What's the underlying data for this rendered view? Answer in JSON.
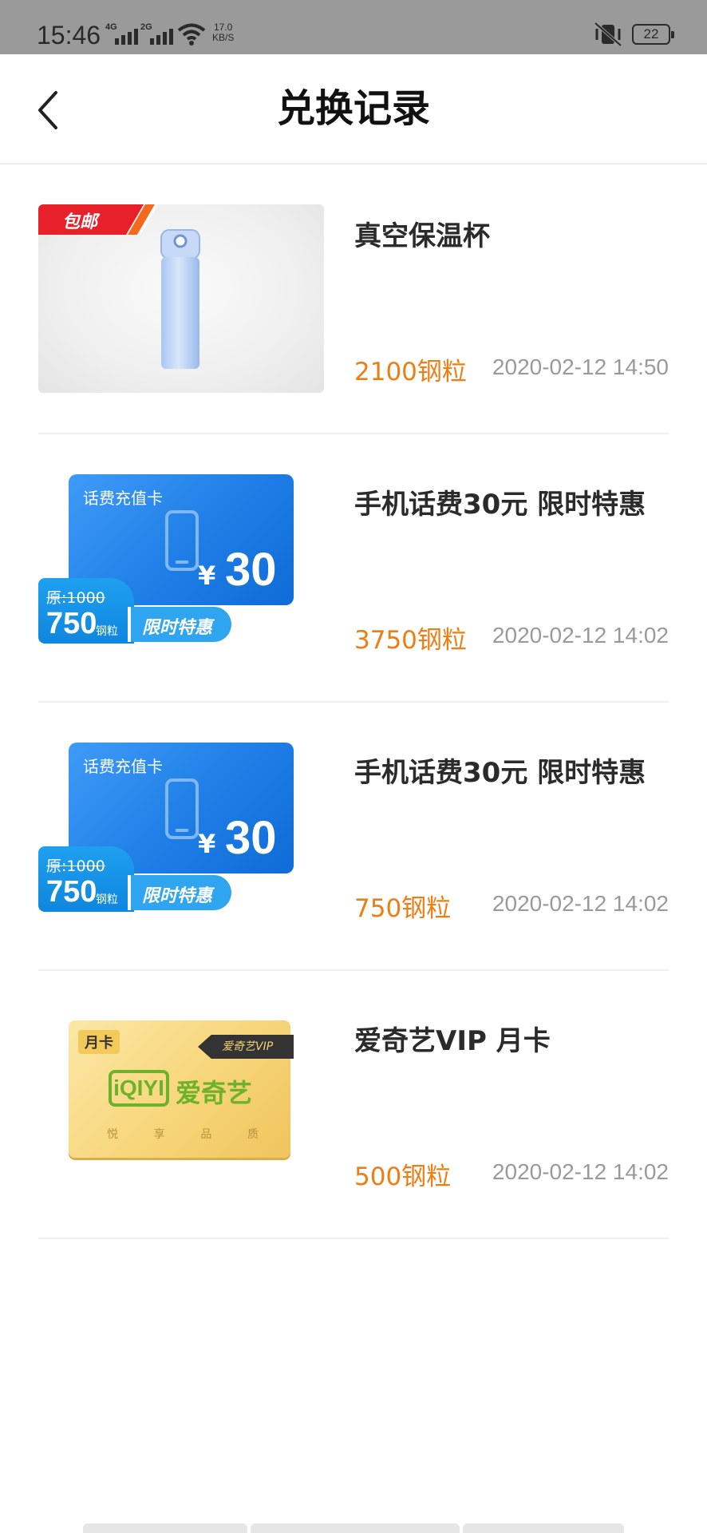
{
  "status_bar": {
    "time": "15:46",
    "net1": "4G",
    "net2": "2G",
    "speed_value": "17.0",
    "speed_unit": "KB/S",
    "battery": "22"
  },
  "header": {
    "title": "兑换记录",
    "back_icon": "chevron-left-icon"
  },
  "colors": {
    "points": "#f07d11",
    "date": "#9a9a9a",
    "title": "#2b2b2b"
  },
  "records": [
    {
      "title": "真空保温杯",
      "points": "2100钢粒",
      "date": "2020-02-12 14:50",
      "thumb": {
        "type": "thermos",
        "ribbon": "包邮"
      }
    },
    {
      "title": "手机话费30元 限时特惠",
      "points": "3750钢粒",
      "date": "2020-02-12 14:02",
      "thumb": {
        "type": "phone-card",
        "card_label": "话费充值卡",
        "yen": "¥",
        "amount": "30",
        "orig": "原:1000",
        "now": "750",
        "now_unit": "钢粒",
        "tag": "限时特惠"
      }
    },
    {
      "title": "手机话费30元 限时特惠",
      "points": "750钢粒",
      "date": "2020-02-12 14:02",
      "thumb": {
        "type": "phone-card",
        "card_label": "话费充值卡",
        "yen": "¥",
        "amount": "30",
        "orig": "原:1000",
        "now": "750",
        "now_unit": "钢粒",
        "tag": "限时特惠"
      }
    },
    {
      "title": "爱奇艺VIP 月卡",
      "points": "500钢粒",
      "date": "2020-02-12 14:02",
      "thumb": {
        "type": "iqiyi-card",
        "month_card": "月卡",
        "vip_tag": "爱奇艺VIP",
        "logo": "iQIYI",
        "brand_cn": "爱奇艺",
        "slogan": [
          "悦",
          "享",
          "品",
          "质"
        ]
      }
    }
  ]
}
